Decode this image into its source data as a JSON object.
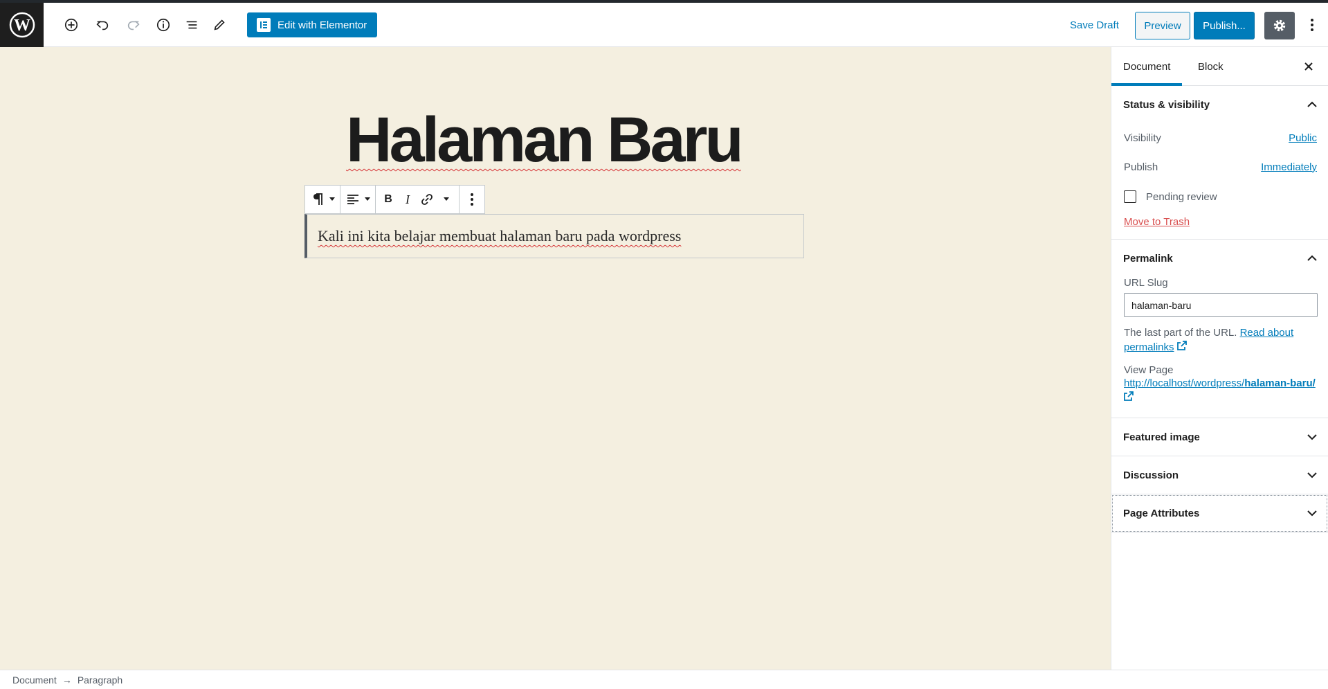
{
  "header": {
    "elementor_label": "Edit with Elementor",
    "save_draft": "Save Draft",
    "preview": "Preview",
    "publish": "Publish..."
  },
  "editor": {
    "title": "Halaman Baru",
    "paragraph": "Kali ini kita belajar membuat halaman baru pada wordpress"
  },
  "sidebar": {
    "tabs": [
      "Document",
      "Block"
    ],
    "status": {
      "title": "Status & visibility",
      "visibility_label": "Visibility",
      "visibility_value": "Public",
      "publish_label": "Publish",
      "publish_value": "Immediately",
      "pending_review": "Pending review",
      "move_to_trash": "Move to Trash"
    },
    "permalink": {
      "title": "Permalink",
      "slug_label": "URL Slug",
      "slug_value": "halaman-baru",
      "help_text": "The last part of the URL.",
      "help_link_1": "Read about",
      "help_link_2": "permalinks",
      "view_page_label": "View Page",
      "url_base": "http://localhost/wordpress/",
      "url_slug": "halaman-baru/"
    },
    "featured_image": "Featured image",
    "discussion": "Discussion",
    "page_attributes": "Page Attributes"
  },
  "footer": {
    "crumbs": [
      "Document",
      "Paragraph"
    ],
    "separator": "→"
  },
  "colors": {
    "accent": "#007cba",
    "canvas_bg": "#f4efe0",
    "trash": "#d94f4f"
  }
}
